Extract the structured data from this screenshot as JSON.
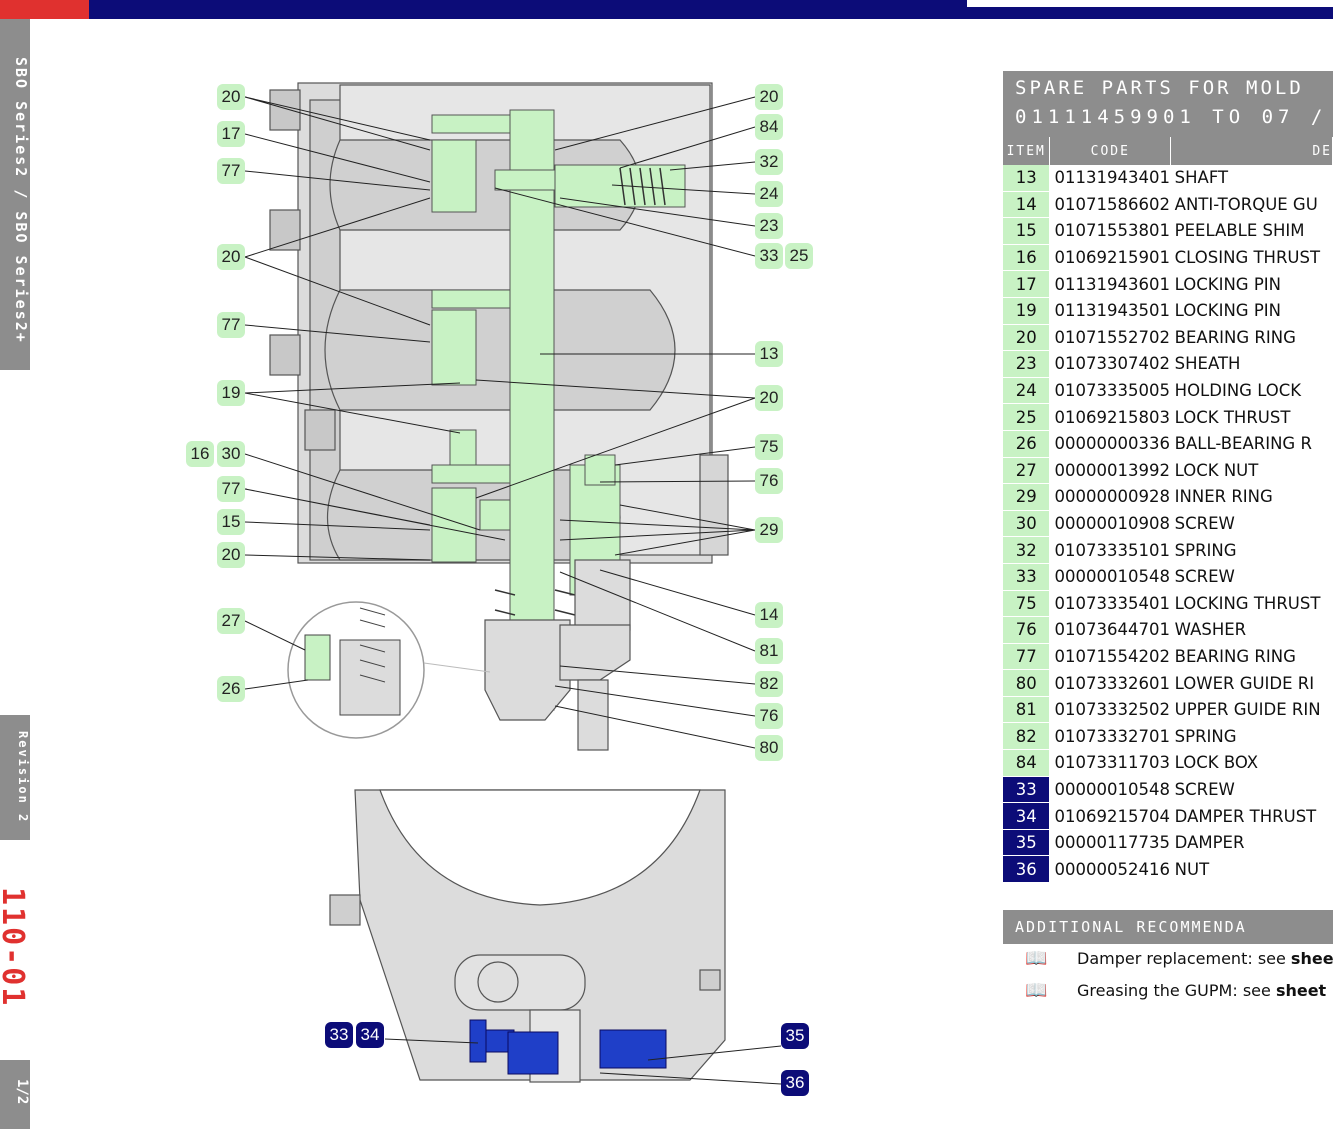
{
  "sidebar": {
    "series": "SBO Series2 / SBO Series2+",
    "revision": "Revision 2",
    "page_code": "110-01",
    "page_number": "1/2"
  },
  "diagram_callouts": {
    "upper": [
      "20",
      "17",
      "77",
      "20",
      "77",
      "19",
      "16",
      "30",
      "77",
      "15",
      "20",
      "27",
      "26",
      "20",
      "84",
      "32",
      "24",
      "23",
      "33",
      "25",
      "13",
      "20",
      "75",
      "76",
      "29",
      "14",
      "81",
      "82",
      "76",
      "80"
    ],
    "lower": [
      "33",
      "34",
      "35",
      "36"
    ]
  },
  "parts": {
    "title_line1": "Spare Parts for Mold",
    "title_line2": "01111459901 to 07 /",
    "headers": [
      "Item",
      "Code",
      "De"
    ],
    "rows": [
      {
        "item": "13",
        "code": "01131943401",
        "desc": "SHAFT",
        "highlight": "green"
      },
      {
        "item": "14",
        "code": "01071586602",
        "desc": "ANTI-TORQUE GU",
        "highlight": "green"
      },
      {
        "item": "15",
        "code": "01071553801",
        "desc": "PEELABLE SHIM",
        "highlight": "green"
      },
      {
        "item": "16",
        "code": "01069215901",
        "desc": "CLOSING THRUST",
        "highlight": "green"
      },
      {
        "item": "17",
        "code": "01131943601",
        "desc": "LOCKING PIN",
        "highlight": "green"
      },
      {
        "item": "19",
        "code": "01131943501",
        "desc": "LOCKING PIN",
        "highlight": "green"
      },
      {
        "item": "20",
        "code": "01071552702",
        "desc": "BEARING RING",
        "highlight": "green"
      },
      {
        "item": "23",
        "code": "01073307402",
        "desc": "SHEATH",
        "highlight": "green"
      },
      {
        "item": "24",
        "code": "01073335005",
        "desc": "HOLDING LOCK",
        "highlight": "green"
      },
      {
        "item": "25",
        "code": "01069215803",
        "desc": "LOCK THRUST",
        "highlight": "green"
      },
      {
        "item": "26",
        "code": "00000000336",
        "desc": "BALL-BEARING R",
        "highlight": "green"
      },
      {
        "item": "27",
        "code": "00000013992",
        "desc": "LOCK NUT",
        "highlight": "green"
      },
      {
        "item": "29",
        "code": "00000000928",
        "desc": "INNER RING",
        "highlight": "green"
      },
      {
        "item": "30",
        "code": "00000010908",
        "desc": "SCREW",
        "highlight": "green"
      },
      {
        "item": "32",
        "code": "01073335101",
        "desc": "SPRING",
        "highlight": "green"
      },
      {
        "item": "33",
        "code": "00000010548",
        "desc": "SCREW",
        "highlight": "green"
      },
      {
        "item": "75",
        "code": "01073335401",
        "desc": "LOCKING THRUST",
        "highlight": "green"
      },
      {
        "item": "76",
        "code": "01073644701",
        "desc": "WASHER",
        "highlight": "green"
      },
      {
        "item": "77",
        "code": "01071554202",
        "desc": "BEARING RING",
        "highlight": "green"
      },
      {
        "item": "80",
        "code": "01073332601",
        "desc": "LOWER GUIDE RI",
        "highlight": "green"
      },
      {
        "item": "81",
        "code": "01073332502",
        "desc": "UPPER GUIDE RIN",
        "highlight": "green"
      },
      {
        "item": "82",
        "code": "01073332701",
        "desc": "SPRING",
        "highlight": "green"
      },
      {
        "item": "84",
        "code": "01073311703",
        "desc": "LOCK BOX",
        "highlight": "green"
      },
      {
        "item": "33",
        "code": "00000010548",
        "desc": "SCREW",
        "highlight": "blue"
      },
      {
        "item": "34",
        "code": "01069215704",
        "desc": "DAMPER THRUST",
        "highlight": "blue"
      },
      {
        "item": "35",
        "code": "00000117735",
        "desc": "DAMPER",
        "highlight": "blue"
      },
      {
        "item": "36",
        "code": "00000052416",
        "desc": "NUT",
        "highlight": "blue"
      }
    ]
  },
  "recommendations": {
    "title": "Additional recommenda",
    "items": [
      {
        "text": "Damper replacement: see ",
        "bold": "shee"
      },
      {
        "text": "Greasing the GUPM: see ",
        "bold": "sheet"
      }
    ]
  },
  "colors": {
    "red": "#e0312f",
    "navy": "#0c0c78",
    "green_highlight": "#c8f2c4",
    "gray": "#8d8d8d"
  }
}
